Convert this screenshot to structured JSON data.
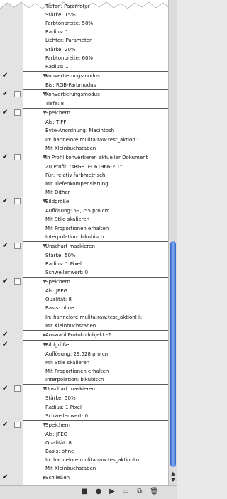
{
  "entries": [
    {
      "type": "sub",
      "text": "Tiefen: Parameter"
    },
    {
      "type": "sub",
      "text": "Stärke: 15%"
    },
    {
      "type": "sub",
      "text": "Farbtonbreite: 50%"
    },
    {
      "type": "sub",
      "text": "Radius: 1"
    },
    {
      "type": "sub",
      "text": "Lichter: Parameter"
    },
    {
      "type": "sub",
      "text": "Stärke: 20%"
    },
    {
      "type": "sub",
      "text": "Farbtonbreite: 60%"
    },
    {
      "type": "sub",
      "text": "Radius: 1"
    },
    {
      "type": "step",
      "text": "Konvertierungsmodus",
      "checked": true,
      "box": false
    },
    {
      "type": "sub",
      "text": "Bis: RGB-Farbmodus"
    },
    {
      "type": "step",
      "text": "Konvertierungsmodus",
      "checked": true,
      "box": true
    },
    {
      "type": "sub",
      "text": "Tiefe: 8"
    },
    {
      "type": "step",
      "text": "Speichern",
      "checked": true,
      "box": true
    },
    {
      "type": "sub",
      "text": "Als: TIFF"
    },
    {
      "type": "sub",
      "text": "Byte-Anordnung: Macintosh"
    },
    {
      "type": "sub",
      "text": "In: hannelore:mulita:raw:test_aktion :"
    },
    {
      "type": "sub",
      "text": "Mit Kleinbuchstaben"
    },
    {
      "type": "step",
      "text": "In Profil konvertieren aktueller Dokument",
      "checked": true,
      "box": true
    },
    {
      "type": "sub",
      "text": "Zu Profil:  \"sRGB IEC61966-2.1\""
    },
    {
      "type": "sub",
      "text": "Für: relativ farbmetrisch"
    },
    {
      "type": "sub",
      "text": "Mit Tiefenkompensierung"
    },
    {
      "type": "sub",
      "text": "Mit Dither"
    },
    {
      "type": "step",
      "text": "Bildgröße",
      "checked": true,
      "box": true
    },
    {
      "type": "sub",
      "text": "Auflösung: 59,055 pro cm"
    },
    {
      "type": "sub",
      "text": "Mit Stile skalieren"
    },
    {
      "type": "sub",
      "text": "Mit Proportionen erhalten"
    },
    {
      "type": "sub",
      "text": "Interpolation: bikubisch"
    },
    {
      "type": "step",
      "text": "Unscharf maskieren",
      "checked": true,
      "box": true
    },
    {
      "type": "sub",
      "text": "Stärke: 50%"
    },
    {
      "type": "sub",
      "text": "Radius: 1 Pixel"
    },
    {
      "type": "sub",
      "text": "Schwellenwert: 0"
    },
    {
      "type": "step",
      "text": "Speichern",
      "checked": true,
      "box": true
    },
    {
      "type": "sub",
      "text": "Als: JPEG"
    },
    {
      "type": "sub",
      "text": "Qualität: 8"
    },
    {
      "type": "sub",
      "text": "Basis: ohne"
    },
    {
      "type": "sub",
      "text": "In: hannelore:mulita:raw:test_aktionHi:"
    },
    {
      "type": "sub",
      "text": "Mit Kleinbuchstaben"
    },
    {
      "type": "step",
      "text": "Auswahl Protokollobjekt -2",
      "checked": true,
      "box": false,
      "collapsed": true
    },
    {
      "type": "step",
      "text": "Bildgröße",
      "checked": true,
      "box": false
    },
    {
      "type": "sub",
      "text": "Auflösung: 29,528 pro cm"
    },
    {
      "type": "sub",
      "text": "Mit Stile skalieren"
    },
    {
      "type": "sub",
      "text": "Mit Proportionen erhalten"
    },
    {
      "type": "sub",
      "text": "Interpolation: bikubisch"
    },
    {
      "type": "step",
      "text": "Unscharf maskieren",
      "checked": true,
      "box": true
    },
    {
      "type": "sub",
      "text": "Stärke: 50%"
    },
    {
      "type": "sub",
      "text": "Radius: 1 Pixel"
    },
    {
      "type": "sub",
      "text": "Schwellenwert: 0"
    },
    {
      "type": "step",
      "text": "Speichern",
      "checked": true,
      "box": true
    },
    {
      "type": "sub",
      "text": "Als: JPEG"
    },
    {
      "type": "sub",
      "text": "Qualität: 8"
    },
    {
      "type": "sub",
      "text": "Basis: ohne"
    },
    {
      "type": "sub",
      "text": "In: hannelore:mulita:raw:tes_aktionLo:"
    },
    {
      "type": "sub",
      "text": "Mit Kleinbuchstaben"
    },
    {
      "type": "step",
      "text": "Schließen",
      "checked": true,
      "box": false,
      "collapsed": true
    }
  ],
  "toolbar": {
    "icons": [
      "stop-icon",
      "record-icon",
      "play-icon",
      "new-set-icon",
      "new-action-icon",
      "trash-icon"
    ],
    "glyphs": [
      "■",
      "●",
      "▶",
      "▭",
      "⧉",
      "🗑"
    ]
  },
  "colors": {
    "scroll_thumb": "#4a7fd8",
    "separator": "#5a5a5a"
  }
}
